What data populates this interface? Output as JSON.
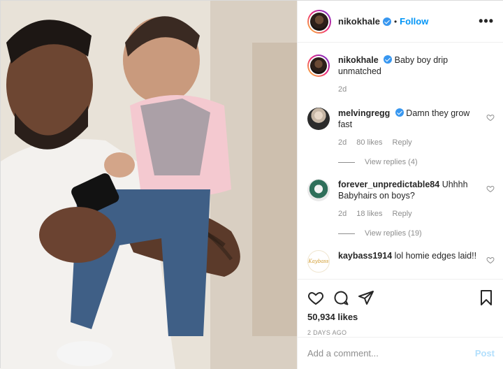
{
  "post": {
    "author": "nikokhale",
    "follow_label": "Follow",
    "dot": "•",
    "more_label": "•••"
  },
  "caption": {
    "user": "nikokhale",
    "text": "Baby boy drip unmatched",
    "time": "2d"
  },
  "comments": [
    {
      "user": "melvingregg",
      "verified": true,
      "text": "Damn they grow fast",
      "time": "2d",
      "likes": "80 likes",
      "reply_label": "Reply",
      "view_replies": "View replies (4)"
    },
    {
      "user": "forever_unpredictable84",
      "verified": false,
      "text": "Uhhhh Babyhairs on boys?",
      "time": "2d",
      "likes": "18 likes",
      "reply_label": "Reply",
      "view_replies": "View replies (19)"
    },
    {
      "user": "kaybass1914",
      "verified": false,
      "text": "lol homie edges laid!!",
      "avatar_text": "Kaybass"
    }
  ],
  "stats": {
    "likes": "50,934 likes",
    "posted": "2 DAYS AGO"
  },
  "composer": {
    "placeholder": "Add a comment...",
    "post_label": "Post"
  },
  "icons": [
    "more-icon",
    "verified-badge-icon",
    "heart-icon",
    "comment-icon",
    "share-icon",
    "bookmark-icon"
  ],
  "colors": {
    "follow": "#0095f6",
    "verified": "#3897f0",
    "post_disabled": "#b2dffc",
    "muted": "#8e8e8e"
  }
}
